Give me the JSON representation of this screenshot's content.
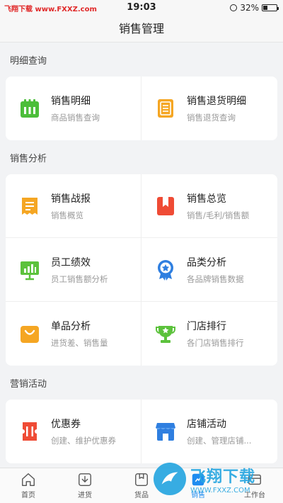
{
  "status_bar": {
    "watermark": "飞翔下载 www.FXXZ.com",
    "time": "19:03",
    "battery": "32%"
  },
  "nav": {
    "title": "销售管理"
  },
  "sections": [
    {
      "title": "明细查询"
    },
    {
      "title": "销售分析"
    },
    {
      "title": "营销活动"
    }
  ],
  "items": {
    "sales_detail": {
      "title": "销售明细",
      "subtitle": "商品销售查询",
      "icon": "calendar-icon",
      "color": "#4cbe3a"
    },
    "return_detail": {
      "title": "销售退货明细",
      "subtitle": "销售退货查询",
      "icon": "document-icon",
      "color": "#f5a623"
    },
    "sales_report": {
      "title": "销售战报",
      "subtitle": "销售概览",
      "icon": "receipt-icon",
      "color": "#f5a623"
    },
    "sales_overview": {
      "title": "销售总览",
      "subtitle": "销售/毛利/销售额",
      "icon": "bookmark-icon",
      "color": "#ef4b35"
    },
    "staff_performance": {
      "title": "员工绩效",
      "subtitle": "员工销售额分析",
      "icon": "presentation-chart-icon",
      "color": "#5cc23c"
    },
    "category_analysis": {
      "title": "品类分析",
      "subtitle": "各品牌销售数据",
      "icon": "award-badge-icon",
      "color": "#2f7fe0"
    },
    "product_analysis": {
      "title": "单品分析",
      "subtitle": "进货差、销售量",
      "icon": "shopping-bag-icon",
      "color": "#f5a623"
    },
    "store_ranking": {
      "title": "门店排行",
      "subtitle": "各门店销售排行",
      "icon": "trophy-icon",
      "color": "#5cc23c"
    },
    "coupon": {
      "title": "优惠券",
      "subtitle": "创建、维护优惠券",
      "icon": "coupon-icon",
      "color": "#ef4b35"
    },
    "store_activity": {
      "title": "店铺活动",
      "subtitle": "创建、管理店铺...",
      "icon": "storefront-icon",
      "color": "#2f7fe0"
    }
  },
  "tabs": [
    {
      "label": "首页",
      "icon": "home-icon"
    },
    {
      "label": "进货",
      "icon": "download-icon"
    },
    {
      "label": "货品",
      "icon": "box-icon"
    },
    {
      "label": "销售",
      "icon": "sales-icon",
      "active": true
    },
    {
      "label": "工作台",
      "icon": "workbench-icon"
    }
  ],
  "watermark_overlay": {
    "text": "飞翔下载",
    "url": "WWW.FXXZ.COM"
  }
}
